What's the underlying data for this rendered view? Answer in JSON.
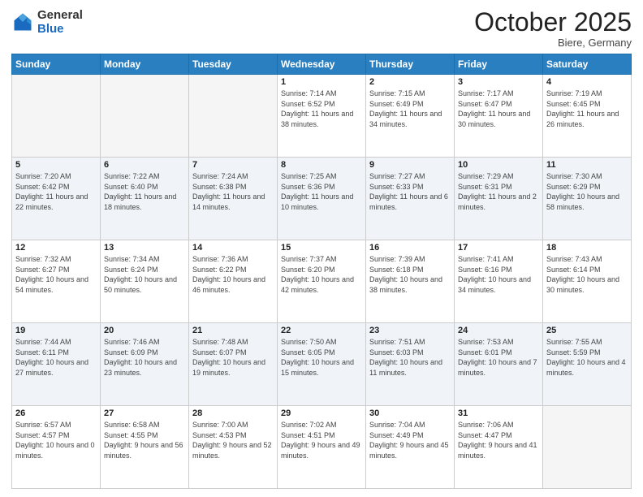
{
  "header": {
    "logo_general": "General",
    "logo_blue": "Blue",
    "month": "October 2025",
    "location": "Biere, Germany"
  },
  "weekdays": [
    "Sunday",
    "Monday",
    "Tuesday",
    "Wednesday",
    "Thursday",
    "Friday",
    "Saturday"
  ],
  "weeks": [
    [
      {
        "day": "",
        "sunrise": "",
        "sunset": "",
        "daylight": ""
      },
      {
        "day": "",
        "sunrise": "",
        "sunset": "",
        "daylight": ""
      },
      {
        "day": "",
        "sunrise": "",
        "sunset": "",
        "daylight": ""
      },
      {
        "day": "1",
        "sunrise": "Sunrise: 7:14 AM",
        "sunset": "Sunset: 6:52 PM",
        "daylight": "Daylight: 11 hours and 38 minutes."
      },
      {
        "day": "2",
        "sunrise": "Sunrise: 7:15 AM",
        "sunset": "Sunset: 6:49 PM",
        "daylight": "Daylight: 11 hours and 34 minutes."
      },
      {
        "day": "3",
        "sunrise": "Sunrise: 7:17 AM",
        "sunset": "Sunset: 6:47 PM",
        "daylight": "Daylight: 11 hours and 30 minutes."
      },
      {
        "day": "4",
        "sunrise": "Sunrise: 7:19 AM",
        "sunset": "Sunset: 6:45 PM",
        "daylight": "Daylight: 11 hours and 26 minutes."
      }
    ],
    [
      {
        "day": "5",
        "sunrise": "Sunrise: 7:20 AM",
        "sunset": "Sunset: 6:42 PM",
        "daylight": "Daylight: 11 hours and 22 minutes."
      },
      {
        "day": "6",
        "sunrise": "Sunrise: 7:22 AM",
        "sunset": "Sunset: 6:40 PM",
        "daylight": "Daylight: 11 hours and 18 minutes."
      },
      {
        "day": "7",
        "sunrise": "Sunrise: 7:24 AM",
        "sunset": "Sunset: 6:38 PM",
        "daylight": "Daylight: 11 hours and 14 minutes."
      },
      {
        "day": "8",
        "sunrise": "Sunrise: 7:25 AM",
        "sunset": "Sunset: 6:36 PM",
        "daylight": "Daylight: 11 hours and 10 minutes."
      },
      {
        "day": "9",
        "sunrise": "Sunrise: 7:27 AM",
        "sunset": "Sunset: 6:33 PM",
        "daylight": "Daylight: 11 hours and 6 minutes."
      },
      {
        "day": "10",
        "sunrise": "Sunrise: 7:29 AM",
        "sunset": "Sunset: 6:31 PM",
        "daylight": "Daylight: 11 hours and 2 minutes."
      },
      {
        "day": "11",
        "sunrise": "Sunrise: 7:30 AM",
        "sunset": "Sunset: 6:29 PM",
        "daylight": "Daylight: 10 hours and 58 minutes."
      }
    ],
    [
      {
        "day": "12",
        "sunrise": "Sunrise: 7:32 AM",
        "sunset": "Sunset: 6:27 PM",
        "daylight": "Daylight: 10 hours and 54 minutes."
      },
      {
        "day": "13",
        "sunrise": "Sunrise: 7:34 AM",
        "sunset": "Sunset: 6:24 PM",
        "daylight": "Daylight: 10 hours and 50 minutes."
      },
      {
        "day": "14",
        "sunrise": "Sunrise: 7:36 AM",
        "sunset": "Sunset: 6:22 PM",
        "daylight": "Daylight: 10 hours and 46 minutes."
      },
      {
        "day": "15",
        "sunrise": "Sunrise: 7:37 AM",
        "sunset": "Sunset: 6:20 PM",
        "daylight": "Daylight: 10 hours and 42 minutes."
      },
      {
        "day": "16",
        "sunrise": "Sunrise: 7:39 AM",
        "sunset": "Sunset: 6:18 PM",
        "daylight": "Daylight: 10 hours and 38 minutes."
      },
      {
        "day": "17",
        "sunrise": "Sunrise: 7:41 AM",
        "sunset": "Sunset: 6:16 PM",
        "daylight": "Daylight: 10 hours and 34 minutes."
      },
      {
        "day": "18",
        "sunrise": "Sunrise: 7:43 AM",
        "sunset": "Sunset: 6:14 PM",
        "daylight": "Daylight: 10 hours and 30 minutes."
      }
    ],
    [
      {
        "day": "19",
        "sunrise": "Sunrise: 7:44 AM",
        "sunset": "Sunset: 6:11 PM",
        "daylight": "Daylight: 10 hours and 27 minutes."
      },
      {
        "day": "20",
        "sunrise": "Sunrise: 7:46 AM",
        "sunset": "Sunset: 6:09 PM",
        "daylight": "Daylight: 10 hours and 23 minutes."
      },
      {
        "day": "21",
        "sunrise": "Sunrise: 7:48 AM",
        "sunset": "Sunset: 6:07 PM",
        "daylight": "Daylight: 10 hours and 19 minutes."
      },
      {
        "day": "22",
        "sunrise": "Sunrise: 7:50 AM",
        "sunset": "Sunset: 6:05 PM",
        "daylight": "Daylight: 10 hours and 15 minutes."
      },
      {
        "day": "23",
        "sunrise": "Sunrise: 7:51 AM",
        "sunset": "Sunset: 6:03 PM",
        "daylight": "Daylight: 10 hours and 11 minutes."
      },
      {
        "day": "24",
        "sunrise": "Sunrise: 7:53 AM",
        "sunset": "Sunset: 6:01 PM",
        "daylight": "Daylight: 10 hours and 7 minutes."
      },
      {
        "day": "25",
        "sunrise": "Sunrise: 7:55 AM",
        "sunset": "Sunset: 5:59 PM",
        "daylight": "Daylight: 10 hours and 4 minutes."
      }
    ],
    [
      {
        "day": "26",
        "sunrise": "Sunrise: 6:57 AM",
        "sunset": "Sunset: 4:57 PM",
        "daylight": "Daylight: 10 hours and 0 minutes."
      },
      {
        "day": "27",
        "sunrise": "Sunrise: 6:58 AM",
        "sunset": "Sunset: 4:55 PM",
        "daylight": "Daylight: 9 hours and 56 minutes."
      },
      {
        "day": "28",
        "sunrise": "Sunrise: 7:00 AM",
        "sunset": "Sunset: 4:53 PM",
        "daylight": "Daylight: 9 hours and 52 minutes."
      },
      {
        "day": "29",
        "sunrise": "Sunrise: 7:02 AM",
        "sunset": "Sunset: 4:51 PM",
        "daylight": "Daylight: 9 hours and 49 minutes."
      },
      {
        "day": "30",
        "sunrise": "Sunrise: 7:04 AM",
        "sunset": "Sunset: 4:49 PM",
        "daylight": "Daylight: 9 hours and 45 minutes."
      },
      {
        "day": "31",
        "sunrise": "Sunrise: 7:06 AM",
        "sunset": "Sunset: 4:47 PM",
        "daylight": "Daylight: 9 hours and 41 minutes."
      },
      {
        "day": "",
        "sunrise": "",
        "sunset": "",
        "daylight": ""
      }
    ]
  ]
}
